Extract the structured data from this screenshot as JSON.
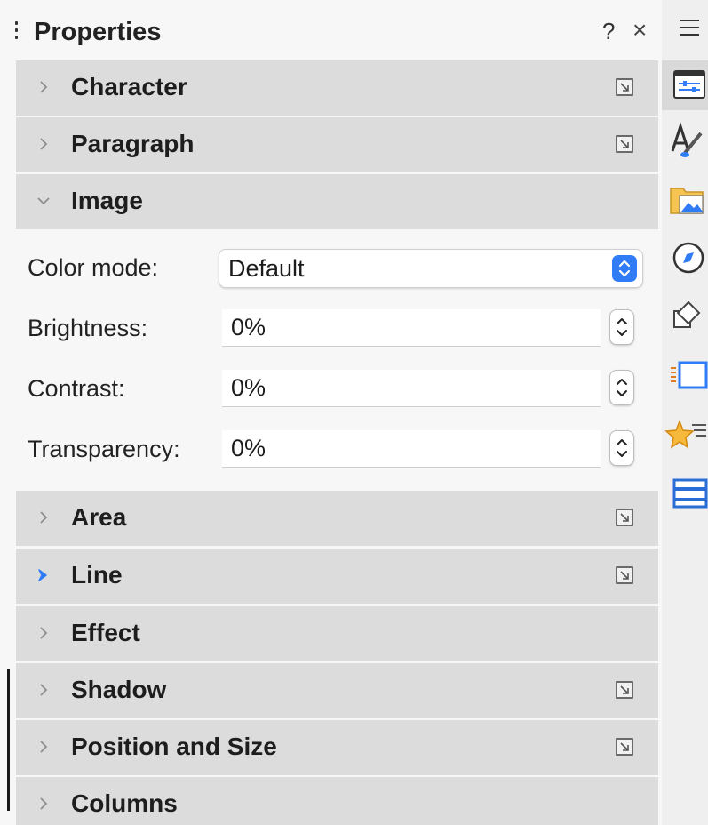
{
  "panel": {
    "title": "Properties",
    "help_label": "?",
    "close_label": "×"
  },
  "sections": {
    "character": "Character",
    "paragraph": "Paragraph",
    "image": "Image",
    "area": "Area",
    "line": "Line",
    "effect": "Effect",
    "shadow": "Shadow",
    "position_size": "Position and Size",
    "columns": "Columns"
  },
  "image": {
    "color_mode_label": "Color mode:",
    "color_mode_value": "Default",
    "brightness_label": "Brightness:",
    "brightness_value": "0%",
    "contrast_label": "Contrast:",
    "contrast_value": "0%",
    "transparency_label": "Transparency:",
    "transparency_value": "0%"
  },
  "tabs": [
    "properties-icon",
    "styles-icon",
    "gallery-icon",
    "navigator-icon",
    "shapes-icon",
    "page-icon",
    "style-inspector-icon",
    "master-slides-icon"
  ],
  "colors": {
    "accent": "#2f7cf6",
    "section_bg": "#dcdcdc",
    "panel_bg": "#f7f7f7"
  }
}
